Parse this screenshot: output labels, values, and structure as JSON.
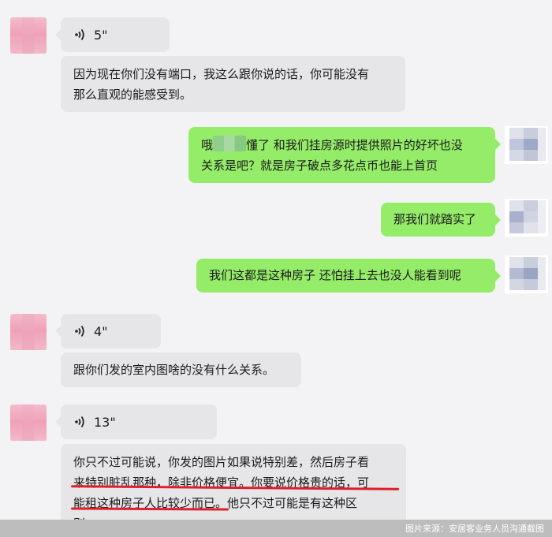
{
  "messages": [
    {
      "type": "voice",
      "side": "left",
      "duration": "5\""
    },
    {
      "type": "text",
      "side": "left",
      "lines": [
        "因为现在你们没有端口，我这么跟你说的话，你可能没有",
        "那么直观的能感受到。"
      ]
    },
    {
      "type": "text",
      "side": "right",
      "line1_before": "哦",
      "line1_after": "懂了 和我们挂房源时提供照片的好坏也没",
      "line2": "关系是吧？就是房子破点多花点币也能上首页"
    },
    {
      "type": "text",
      "side": "right",
      "text": "那我们就踏实了"
    },
    {
      "type": "text",
      "side": "right",
      "text": "我们这都是这种房子 还怕挂上去也没人能看到呢"
    },
    {
      "type": "voice",
      "side": "left",
      "duration": "4\""
    },
    {
      "type": "text",
      "side": "left",
      "text": "跟你们发的室内图啥的没有什么关系。"
    },
    {
      "type": "voice",
      "side": "left",
      "duration": "13\""
    },
    {
      "type": "text",
      "side": "left",
      "lines": [
        "你只不过可能说，你发的图片如果说特别差，然后房子看",
        "来特别脏乱那种，除非价格便宜。你要说价格贵的话，可",
        "能租这种房子人比较少而已。他只不过可能是有这种区",
        "别。"
      ]
    }
  ],
  "footer": {
    "caption": "图片来源：安居客业务人员沟通截图"
  },
  "colors": {
    "incoming": "#e6e6e9",
    "outgoing": "#95ec69",
    "underline": "#e01e2d",
    "background": "#f3f3f5"
  },
  "icons": {
    "voice": "voice-wave-icon"
  }
}
